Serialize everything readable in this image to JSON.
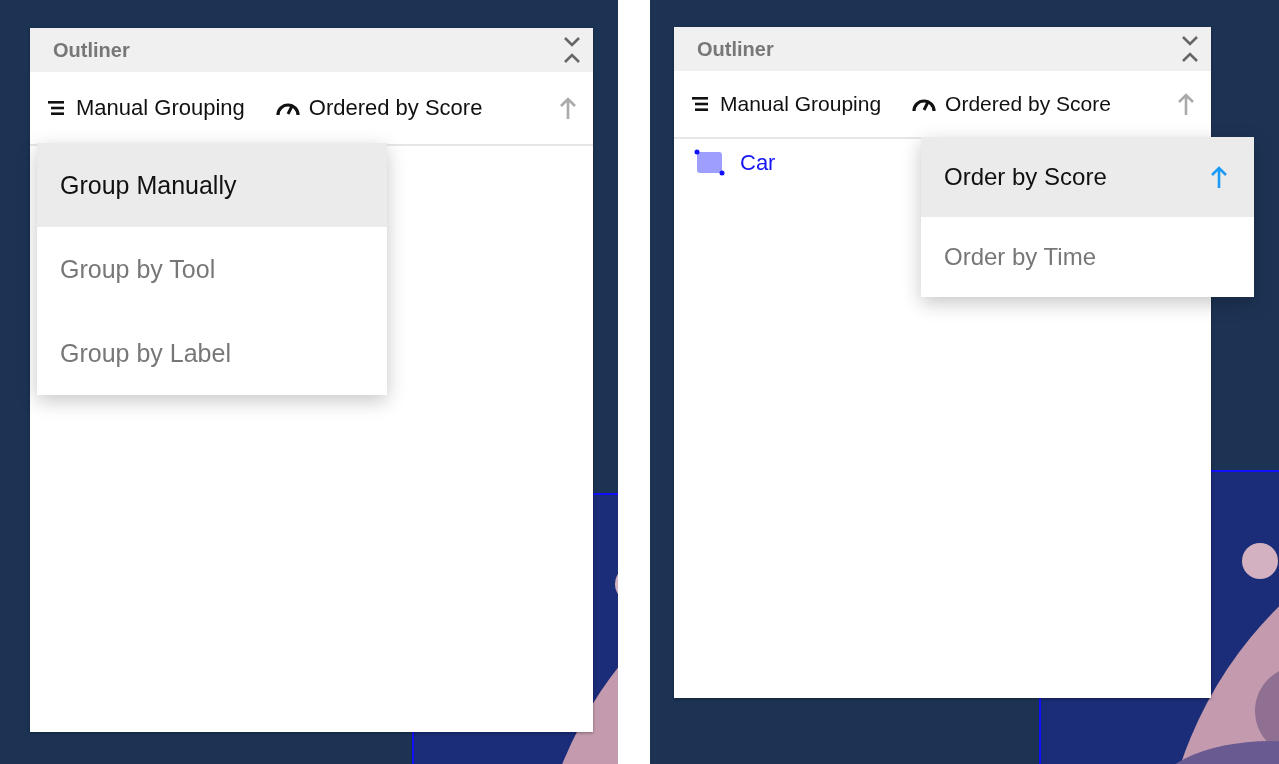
{
  "screens": [
    {
      "panel": {
        "title": "Outliner",
        "grouping": {
          "label": "Manual Grouping"
        },
        "ordering": {
          "label": "Ordered by Score"
        }
      },
      "menu": {
        "kind": "grouping",
        "options": [
          {
            "label": "Group Manually",
            "selected": true
          },
          {
            "label": "Group by Tool",
            "selected": false
          },
          {
            "label": "Group by Label",
            "selected": false
          }
        ]
      }
    },
    {
      "panel": {
        "title": "Outliner",
        "grouping": {
          "label": "Manual Grouping"
        },
        "ordering": {
          "label": "Ordered by Score"
        },
        "items": [
          {
            "label": "Car"
          }
        ]
      },
      "menu": {
        "kind": "ordering",
        "options": [
          {
            "label": "Order by Score",
            "selected": true
          },
          {
            "label": "Order by Time",
            "selected": false
          }
        ]
      }
    }
  ]
}
